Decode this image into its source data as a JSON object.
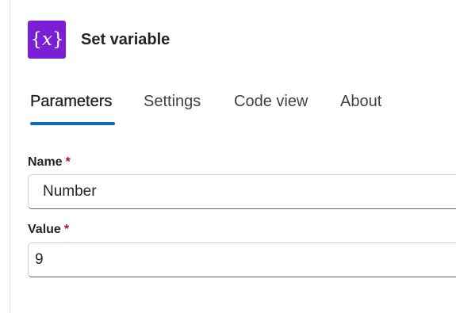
{
  "action": {
    "title": "Set variable",
    "icon": "variable-icon",
    "icon_color": "#7a1fd6"
  },
  "tabs": [
    {
      "label": "Parameters",
      "active": true
    },
    {
      "label": "Settings",
      "active": false
    },
    {
      "label": "Code view",
      "active": false
    },
    {
      "label": "About",
      "active": false
    }
  ],
  "accent_color": "#0f6cbd",
  "required_marker": "*",
  "fields": {
    "name": {
      "label": "Name",
      "value": "Number"
    },
    "value": {
      "label": "Value",
      "value": "9"
    }
  }
}
